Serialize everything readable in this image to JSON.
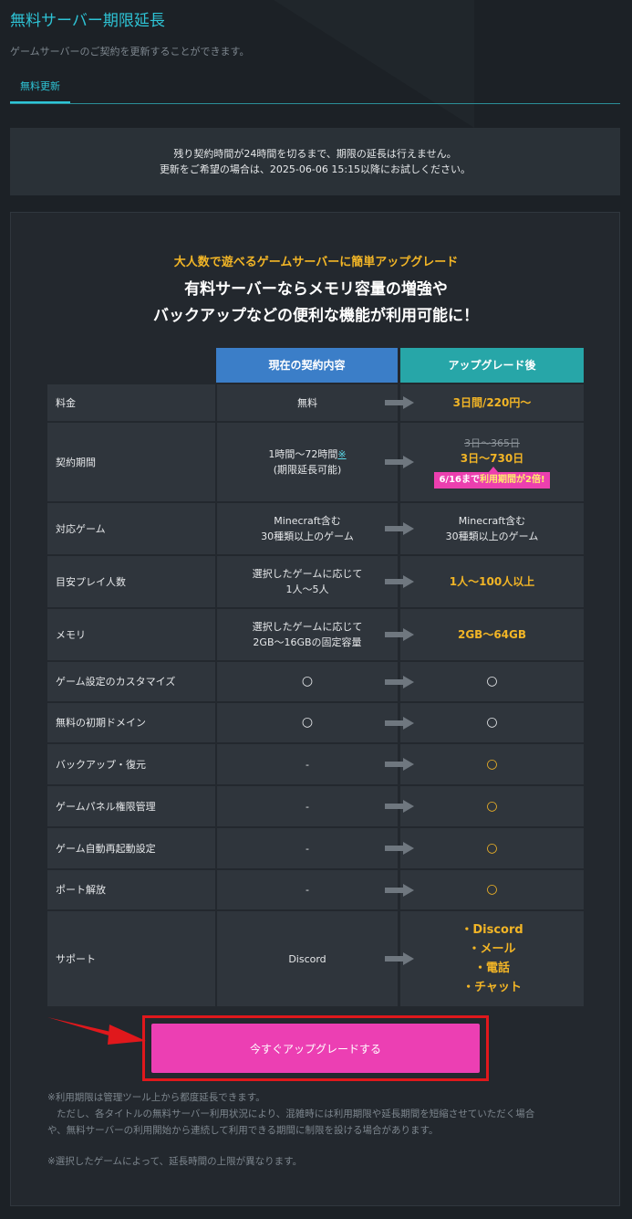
{
  "header": {
    "title": "無料サーバー期限延長",
    "subtitle": "ゲームサーバーのご契約を更新することができます。",
    "tab": "無料更新"
  },
  "notice": {
    "line1": "残り契約時間が24時間を切るまで、期限の延長は行えません。",
    "line2": "更新をご希望の場合は、2025-06-06 15:15以降にお試しください。"
  },
  "promo": {
    "tagline": "大人数で遊べるゲームサーバーに簡単アップグレード",
    "headline1": "有料サーバーならメモリ容量の増強や",
    "headline2": "バックアップなどの便利な機能が利用可能に！"
  },
  "table": {
    "col_current": "現在の契約内容",
    "col_after": "アップグレード後",
    "rows": [
      {
        "label": "料金",
        "current": "無料",
        "after": "3日間/220円～"
      },
      {
        "label": "契約期間",
        "current1": "1時間～72時間",
        "current_link": "※",
        "current2": "(期限延長可能)",
        "after_old": "3日～365日",
        "after": "3日～730日",
        "badge_pre": "6/16まで",
        "badge_hl": "利用期間が2倍!"
      },
      {
        "label": "対応ゲーム",
        "current1": "Minecraft含む",
        "current2": "30種類以上のゲーム",
        "after1": "Minecraft含む",
        "after2": "30種類以上のゲーム"
      },
      {
        "label": "目安プレイ人数",
        "current1": "選択したゲームに応じて",
        "current2": "1人～5人",
        "after": "1人～100人以上"
      },
      {
        "label": "メモリ",
        "current1": "選択したゲームに応じて",
        "current2": "2GB～16GBの固定容量",
        "after": "2GB～64GB"
      },
      {
        "label": "ゲーム設定のカスタマイズ",
        "current": "○",
        "after": "○"
      },
      {
        "label": "無料の初期ドメイン",
        "current": "○",
        "after": "○"
      },
      {
        "label": "バックアップ・復元",
        "current": "-",
        "after": "○"
      },
      {
        "label": "ゲームパネル権限管理",
        "current": "-",
        "after": "○"
      },
      {
        "label": "ゲーム自動再起動設定",
        "current": "-",
        "after": "○"
      },
      {
        "label": "ポート解放",
        "current": "-",
        "after": "○"
      },
      {
        "label": "サポート",
        "current": "Discord",
        "after_list": [
          "・Discord",
          "・メール",
          "・電話",
          "・チャット"
        ]
      }
    ]
  },
  "cta": {
    "label": "今すぐアップグレードする"
  },
  "notes": {
    "n1": "※利用期限は管理ツール上から都度延長できます。",
    "n2": "ただし、各タイトルの無料サーバー利用状況により、混雑時には利用期限や延長期間を短縮させていただく場合",
    "n3": "や、無料サーバーの利用開始から連続して利用できる期間に制限を設ける場合があります。",
    "n4": "※選択したゲームによって、延長時間の上限が異なります。"
  },
  "colors": {
    "accent": "#2ec4d6",
    "gold": "#f2b526",
    "cta": "#ec3fb3",
    "current_header": "#3b7ec8",
    "after_header": "#27a6a8",
    "highlight_box": "#e0181c"
  }
}
